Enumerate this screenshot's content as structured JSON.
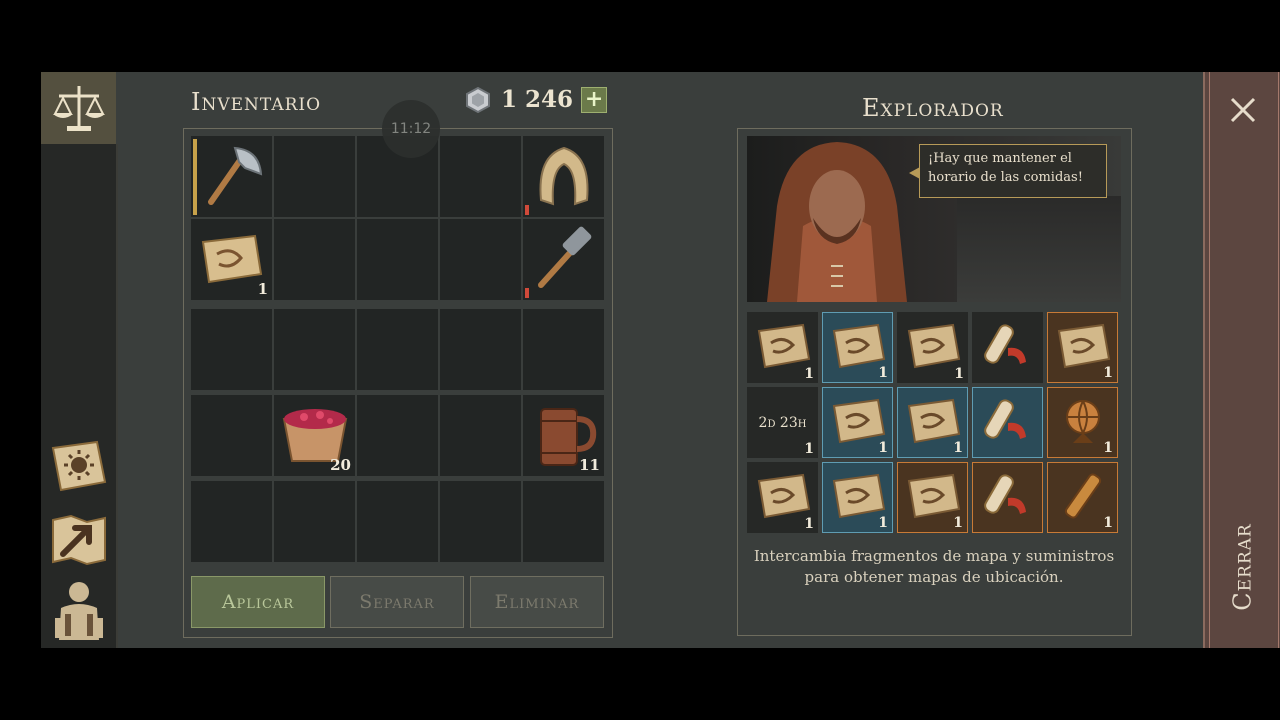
{
  "inventory": {
    "title": "Inventario",
    "currency_amount": "1 246",
    "currency_plus": "+",
    "clock": "11:12",
    "top_slots": [
      {
        "icon": "axe-icon",
        "qty": ""
      },
      {
        "icon": "",
        "qty": ""
      },
      {
        "icon": "",
        "qty": ""
      },
      {
        "icon": "",
        "qty": ""
      },
      {
        "icon": "hood-icon",
        "qty": ""
      },
      {
        "icon": "map-scroll-icon",
        "qty": "1"
      },
      {
        "icon": "",
        "qty": ""
      },
      {
        "icon": "",
        "qty": ""
      },
      {
        "icon": "",
        "qty": ""
      },
      {
        "icon": "hammer-icon",
        "qty": ""
      }
    ],
    "bottom_slots": [
      {
        "icon": "",
        "qty": ""
      },
      {
        "icon": "",
        "qty": ""
      },
      {
        "icon": "",
        "qty": ""
      },
      {
        "icon": "",
        "qty": ""
      },
      {
        "icon": "",
        "qty": ""
      },
      {
        "icon": "",
        "qty": ""
      },
      {
        "icon": "berry-bowl-icon",
        "qty": "20"
      },
      {
        "icon": "",
        "qty": ""
      },
      {
        "icon": "",
        "qty": ""
      },
      {
        "icon": "mug-icon",
        "qty": "11"
      },
      {
        "icon": "",
        "qty": ""
      },
      {
        "icon": "",
        "qty": ""
      },
      {
        "icon": "",
        "qty": ""
      },
      {
        "icon": "",
        "qty": ""
      },
      {
        "icon": "",
        "qty": ""
      }
    ],
    "buttons": {
      "apply": "Aplicar",
      "split": "Separar",
      "delete": "Eliminar"
    }
  },
  "explorer": {
    "title": "Explorador",
    "speech": "¡Hay que mantener el horario de las comidas!",
    "description": "Intercambia fragmentos de mapa y suministros para obtener mapas de ubicación.",
    "items": [
      {
        "icon": "map-fragment-icon",
        "qty": "1",
        "rarity": "none"
      },
      {
        "icon": "map-fragment-icon",
        "qty": "1",
        "rarity": "blue"
      },
      {
        "icon": "map-fragment-icon",
        "qty": "1",
        "rarity": "none"
      },
      {
        "icon": "scroll-ribbon-icon",
        "qty": "",
        "rarity": "none"
      },
      {
        "icon": "map-fragment-icon",
        "qty": "1",
        "rarity": "orange"
      },
      {
        "icon": "timer",
        "qty": "1",
        "rarity": "none",
        "timer": "2d 23h"
      },
      {
        "icon": "map-fragment-icon",
        "qty": "1",
        "rarity": "blue"
      },
      {
        "icon": "map-fragment-icon",
        "qty": "1",
        "rarity": "blue"
      },
      {
        "icon": "scroll-ribbon-icon",
        "qty": "",
        "rarity": "blue"
      },
      {
        "icon": "globe-icon",
        "qty": "1",
        "rarity": "orange"
      },
      {
        "icon": "map-fragment-icon",
        "qty": "1",
        "rarity": "none"
      },
      {
        "icon": "map-fragment-icon",
        "qty": "1",
        "rarity": "blue"
      },
      {
        "icon": "map-fragment-icon",
        "qty": "1",
        "rarity": "orange"
      },
      {
        "icon": "scroll-ribbon-icon",
        "qty": "",
        "rarity": "orange"
      },
      {
        "icon": "spyglass-icon",
        "qty": "1",
        "rarity": "orange"
      }
    ]
  },
  "close": {
    "label": "Cerrar"
  },
  "colors": {
    "background": "#3a3e3c",
    "accent_green": "#5e6b4b",
    "blue_rarity": "#5f9cb2",
    "orange_rarity": "#c87a36"
  }
}
